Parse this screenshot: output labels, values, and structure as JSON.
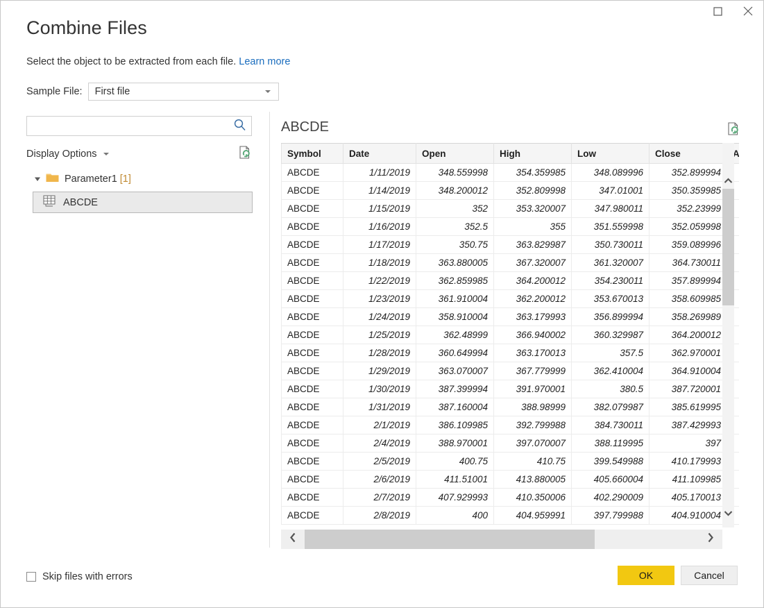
{
  "window": {
    "title": "Combine Files",
    "controls": {
      "maximize": "maximize-icon",
      "close": "close-icon"
    }
  },
  "header": {
    "title": "Combine Files",
    "subtitle": "Select the object to be extracted from each file.",
    "learn_more": "Learn more",
    "sample_file_label": "Sample File:",
    "sample_file_value": "First file"
  },
  "left_pane": {
    "search_placeholder": "",
    "search_value": "",
    "search_icon": "search-icon",
    "display_options_label": "Display Options",
    "refresh_icon": "refresh-icon",
    "tree": {
      "root_label": "Parameter1",
      "root_count": "[1]",
      "child_label": "ABCDE"
    }
  },
  "preview": {
    "title": "ABCDE",
    "refresh_icon": "refresh-icon",
    "columns": [
      "Symbol",
      "Date",
      "Open",
      "High",
      "Low",
      "Close",
      "Ad"
    ],
    "rows": [
      [
        "ABCDE",
        "1/11/2019",
        "348.559998",
        "354.359985",
        "348.089996",
        "352.899994",
        ""
      ],
      [
        "ABCDE",
        "1/14/2019",
        "348.200012",
        "352.809998",
        "347.01001",
        "350.359985",
        ""
      ],
      [
        "ABCDE",
        "1/15/2019",
        "352",
        "353.320007",
        "347.980011",
        "352.23999",
        ""
      ],
      [
        "ABCDE",
        "1/16/2019",
        "352.5",
        "355",
        "351.559998",
        "352.059998",
        ""
      ],
      [
        "ABCDE",
        "1/17/2019",
        "350.75",
        "363.829987",
        "350.730011",
        "359.089996",
        ""
      ],
      [
        "ABCDE",
        "1/18/2019",
        "363.880005",
        "367.320007",
        "361.320007",
        "364.730011",
        ""
      ],
      [
        "ABCDE",
        "1/22/2019",
        "362.859985",
        "364.200012",
        "354.230011",
        "357.899994",
        ""
      ],
      [
        "ABCDE",
        "1/23/2019",
        "361.910004",
        "362.200012",
        "353.670013",
        "358.609985",
        ""
      ],
      [
        "ABCDE",
        "1/24/2019",
        "358.910004",
        "363.179993",
        "356.899994",
        "358.269989",
        ""
      ],
      [
        "ABCDE",
        "1/25/2019",
        "362.48999",
        "366.940002",
        "360.329987",
        "364.200012",
        ""
      ],
      [
        "ABCDE",
        "1/28/2019",
        "360.649994",
        "363.170013",
        "357.5",
        "362.970001",
        ""
      ],
      [
        "ABCDE",
        "1/29/2019",
        "363.070007",
        "367.779999",
        "362.410004",
        "364.910004",
        ""
      ],
      [
        "ABCDE",
        "1/30/2019",
        "387.399994",
        "391.970001",
        "380.5",
        "387.720001",
        ""
      ],
      [
        "ABCDE",
        "1/31/2019",
        "387.160004",
        "388.98999",
        "382.079987",
        "385.619995",
        ""
      ],
      [
        "ABCDE",
        "2/1/2019",
        "386.109985",
        "392.799988",
        "384.730011",
        "387.429993",
        ""
      ],
      [
        "ABCDE",
        "2/4/2019",
        "388.970001",
        "397.070007",
        "388.119995",
        "397",
        ""
      ],
      [
        "ABCDE",
        "2/5/2019",
        "400.75",
        "410.75",
        "399.549988",
        "410.179993",
        ""
      ],
      [
        "ABCDE",
        "2/6/2019",
        "411.51001",
        "413.880005",
        "405.660004",
        "411.109985",
        ""
      ],
      [
        "ABCDE",
        "2/7/2019",
        "407.929993",
        "410.350006",
        "402.290009",
        "405.170013",
        ""
      ],
      [
        "ABCDE",
        "2/8/2019",
        "400",
        "404.959991",
        "397.799988",
        "404.910004",
        ""
      ]
    ]
  },
  "scrollbars": {
    "vertical_up": "chevron-up-icon",
    "vertical_down": "chevron-down-icon",
    "horizontal_left": "chevron-left-icon",
    "horizontal_right": "chevron-right-icon"
  },
  "footer": {
    "skip_label": "Skip files with errors",
    "skip_checked": false,
    "ok_label": "OK",
    "cancel_label": "Cancel"
  },
  "colors": {
    "accent": "#f2c811",
    "link": "#1a6dbe",
    "search_icon": "#3a6ea5",
    "folder": "#f0b64b",
    "count": "#c08a33",
    "refresh_green": "#5aa97a"
  }
}
